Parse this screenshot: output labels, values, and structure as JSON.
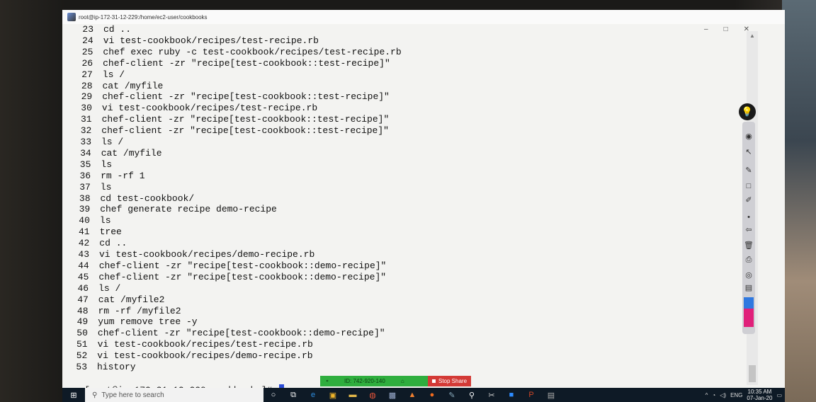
{
  "window": {
    "title": "root@ip-172-31-12-229:/home/ec2-user/cookbooks",
    "controls": [
      "–",
      "□",
      "✕"
    ]
  },
  "history": [
    {
      "num": "23",
      "cmd": "cd .."
    },
    {
      "num": "24",
      "cmd": "vi test-cookbook/recipes/test-recipe.rb"
    },
    {
      "num": "25",
      "cmd": "chef exec ruby -c test-cookbook/recipes/test-recipe.rb"
    },
    {
      "num": "26",
      "cmd": "chef-client -zr \"recipe[test-cookbook::test-recipe]\""
    },
    {
      "num": "27",
      "cmd": "ls /"
    },
    {
      "num": "28",
      "cmd": "cat /myfile"
    },
    {
      "num": "29",
      "cmd": "chef-client -zr \"recipe[test-cookbook::test-recipe]\""
    },
    {
      "num": "30",
      "cmd": "vi test-cookbook/recipes/test-recipe.rb"
    },
    {
      "num": "31",
      "cmd": "chef-client -zr \"recipe[test-cookbook::test-recipe]\""
    },
    {
      "num": "32",
      "cmd": "chef-client -zr \"recipe[test-cookbook::test-recipe]\""
    },
    {
      "num": "33",
      "cmd": "ls /"
    },
    {
      "num": "34",
      "cmd": "cat /myfile"
    },
    {
      "num": "35",
      "cmd": "ls"
    },
    {
      "num": "36",
      "cmd": "rm -rf 1"
    },
    {
      "num": "37",
      "cmd": "ls"
    },
    {
      "num": "38",
      "cmd": "cd test-cookbook/"
    },
    {
      "num": "39",
      "cmd": "chef generate recipe demo-recipe"
    },
    {
      "num": "40",
      "cmd": "ls"
    },
    {
      "num": "41",
      "cmd": "tree"
    },
    {
      "num": "42",
      "cmd": "cd .."
    },
    {
      "num": "43",
      "cmd": "vi test-cookbook/recipes/demo-recipe.rb"
    },
    {
      "num": "44",
      "cmd": "chef-client -zr \"recipe[test-cookbook::demo-recipe]\""
    },
    {
      "num": "45",
      "cmd": "chef-client -zr \"recipe[test-cookbook::demo-recipe]\""
    },
    {
      "num": "46",
      "cmd": "ls /"
    },
    {
      "num": "47",
      "cmd": "cat /myfile2"
    },
    {
      "num": "48",
      "cmd": "rm -rf /myfile2"
    },
    {
      "num": "49",
      "cmd": "yum remove tree -y"
    },
    {
      "num": "50",
      "cmd": "chef-client -zr \"recipe[test-cookbook::demo-recipe]\""
    },
    {
      "num": "51",
      "cmd": "vi test-cookbook/recipes/test-recipe.rb"
    },
    {
      "num": "52",
      "cmd": "vi test-cookbook/recipes/demo-recipe.rb"
    },
    {
      "num": "53",
      "cmd": "history"
    }
  ],
  "prompt": "[root@ip-172-31-12-229 cookbooks]#",
  "screen_share": {
    "id_label": "ID: 742-920-140",
    "stop_label": "Stop Share"
  },
  "taskbar": {
    "search_placeholder": "Type here to search",
    "time": "10:35 AM",
    "date": "07-Jan-20"
  },
  "colors": {
    "terminal_bg": "#f3f3f1",
    "cursor": "#2a4bd7",
    "share_green": "#2fae3e",
    "share_red": "#d33a36",
    "taskbar": "#0e1a26"
  }
}
